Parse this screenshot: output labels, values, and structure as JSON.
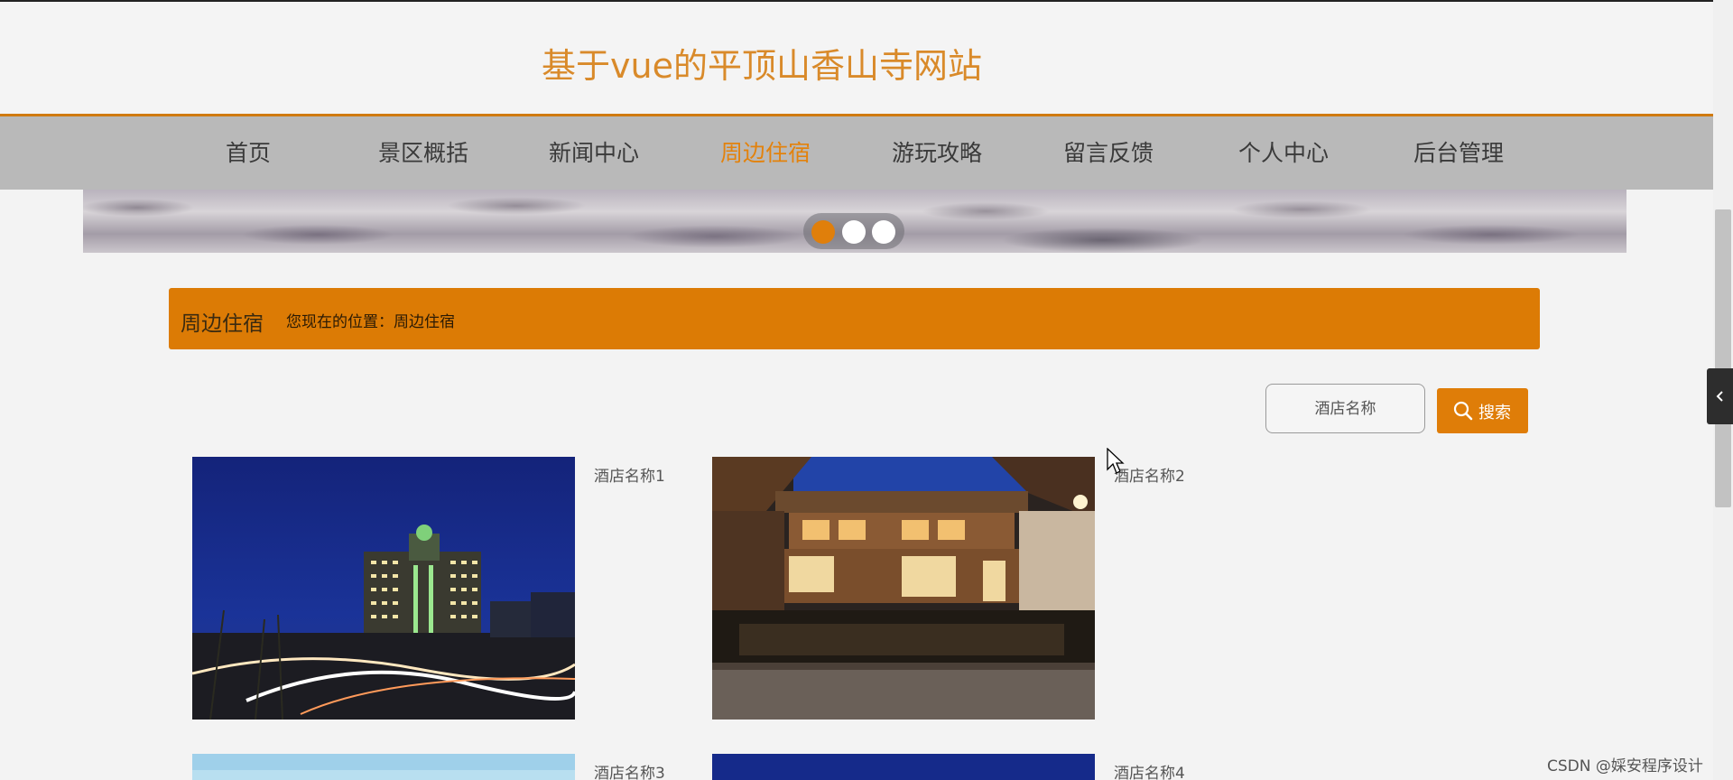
{
  "header": {
    "site_title": "基于vue的平顶山香山寺网站"
  },
  "nav": {
    "items": [
      {
        "label": "首页"
      },
      {
        "label": "景区概括"
      },
      {
        "label": "新闻中心"
      },
      {
        "label": "周边住宿",
        "active": true
      },
      {
        "label": "游玩攻略"
      },
      {
        "label": "留言反馈"
      },
      {
        "label": "个人中心"
      },
      {
        "label": "后台管理"
      }
    ],
    "active_color": "#e3820c"
  },
  "carousel": {
    "slide_count": 3,
    "active_index": 0
  },
  "breadcrumb": {
    "title": "周边住宿",
    "location": "您现在的位置：周边住宿"
  },
  "search": {
    "placeholder": "酒店名称",
    "button_label": "搜索"
  },
  "hotels": [
    {
      "name": "酒店名称1"
    },
    {
      "name": "酒店名称2"
    },
    {
      "name": "酒店名称3"
    },
    {
      "name": "酒店名称4"
    }
  ],
  "watermark": "CSDN @婇安程序设计",
  "colors": {
    "accent": "#dc7b05",
    "nav_bg": "#b9b9b9",
    "page_bg": "#f3f3f3"
  }
}
